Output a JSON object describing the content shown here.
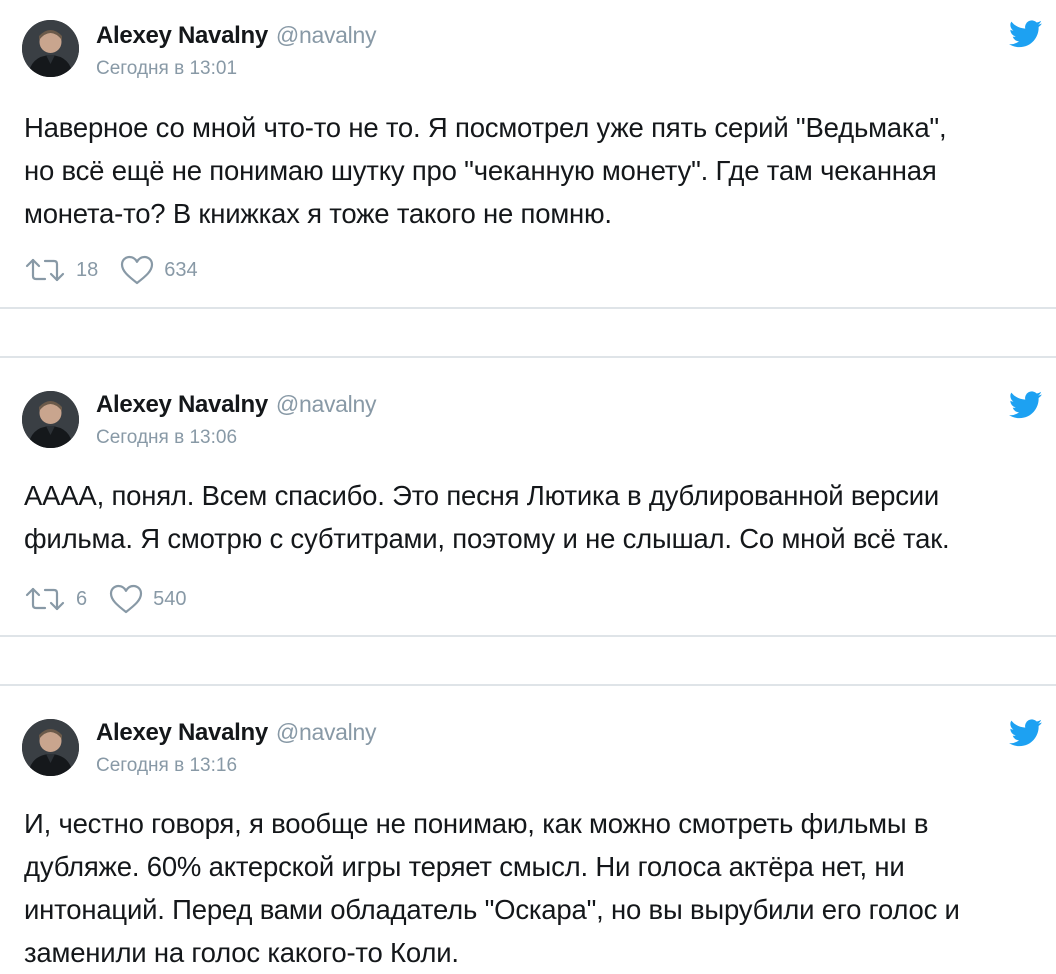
{
  "accent_color": "#1da1f2",
  "tweets": [
    {
      "name": "Alexey Navalny",
      "handle": "@navalny",
      "time": "Сегодня в 13:01",
      "lines": [
        "Наверное со мной что-то не то. Я посмотрел уже пять серий \"Ведьмака\",",
        "но всё ещё не понимаю шутку про \"чеканную монету\". Где там чеканная",
        "монета-то? В книжках я тоже такого не помню."
      ],
      "retweets": "18",
      "likes": "634"
    },
    {
      "name": "Alexey Navalny",
      "handle": "@navalny",
      "time": "Сегодня в 13:06",
      "lines": [
        "АААА, понял. Всем спасибо. Это песня Лютика в дублированной версии",
        "фильма. Я смотрю с субтитрами, поэтому и не слышал. Со мной всё так."
      ],
      "retweets": "6",
      "likes": "540"
    },
    {
      "name": "Alexey Navalny",
      "handle": "@navalny",
      "time": "Сегодня в 13:16",
      "lines": [
        "И, честно говоря, я вообще не понимаю, как можно смотреть фильмы в",
        "дубляже. 60% актерской игры теряет смысл. Ни голоса актёра нет, ни",
        "интонаций. Перед вами обладатель \"Оскара\", но вы вырубили его голос и",
        "заменили на голос какого-то Коли."
      ]
    }
  ]
}
